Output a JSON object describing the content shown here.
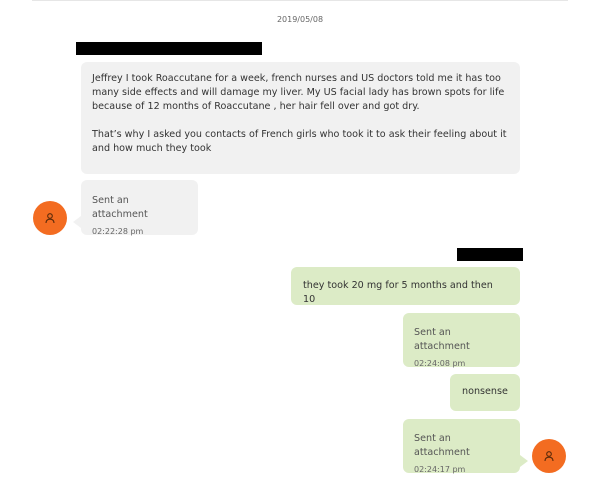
{
  "conversation": {
    "date": "2019/05/08",
    "messages": [
      {
        "paragraphs": [
          "Jeffrey I took Roaccutane for a week, french nurses and US doctors told me it has too many side effects and will damage my liver. My US facial lady has brown spots for life because of 12 months of Roaccutane , her hair fell over and got dry.",
          "That’s why I asked you contacts of French girls who took it to ask their feeling about it and how much they took"
        ]
      },
      {
        "label": "Sent an attachment",
        "time": "02:22:28 pm"
      },
      {
        "text": "they took 20 mg  for 5 months and then 10"
      },
      {
        "label": "Sent an attachment",
        "time": "02:24:08 pm"
      },
      {
        "text": "nonsense"
      },
      {
        "label": "Sent an attachment",
        "time": "02:24:17 pm"
      }
    ]
  },
  "icons": {
    "avatar": "person-icon"
  },
  "colors": {
    "avatar": "#f36c21",
    "incoming_bubble": "#f1f1f1",
    "outgoing_bubble": "#dcebc6"
  }
}
